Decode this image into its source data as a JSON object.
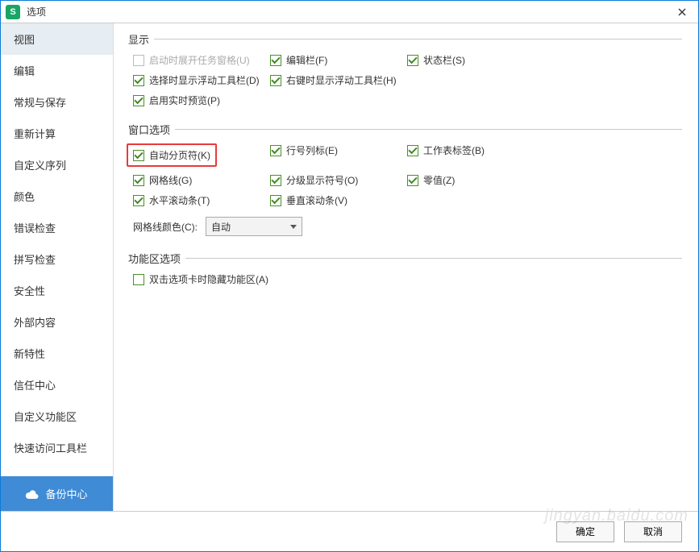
{
  "window": {
    "title": "选项",
    "app_icon_letter": "S"
  },
  "sidebar": {
    "items": [
      {
        "label": "视图",
        "active": true
      },
      {
        "label": "编辑"
      },
      {
        "label": "常规与保存"
      },
      {
        "label": "重新计算"
      },
      {
        "label": "自定义序列"
      },
      {
        "label": "颜色"
      },
      {
        "label": "错误检查"
      },
      {
        "label": "拼写检查"
      },
      {
        "label": "安全性"
      },
      {
        "label": "外部内容"
      },
      {
        "label": "新特性"
      },
      {
        "label": "信任中心"
      },
      {
        "label": "自定义功能区"
      },
      {
        "label": "快速访问工具栏"
      }
    ],
    "backup_label": "备份中心"
  },
  "sections": {
    "display": {
      "title": "显示",
      "items": [
        {
          "label": "启动时展开任务窗格(U)",
          "checked": false,
          "disabled": true
        },
        {
          "label": "编辑栏(F)",
          "checked": true
        },
        {
          "label": "状态栏(S)",
          "checked": true
        },
        {
          "label": "选择时显示浮动工具栏(D)",
          "checked": true
        },
        {
          "label": "右键时显示浮动工具栏(H)",
          "checked": true
        },
        {
          "label": "",
          "checked": false,
          "hidden": true
        },
        {
          "label": "启用实时预览(P)",
          "checked": true
        }
      ]
    },
    "window": {
      "title": "窗口选项",
      "items": [
        {
          "label": "自动分页符(K)",
          "checked": true,
          "highlight": true
        },
        {
          "label": "行号列标(E)",
          "checked": true
        },
        {
          "label": "工作表标签(B)",
          "checked": true
        },
        {
          "label": "网格线(G)",
          "checked": true
        },
        {
          "label": "分级显示符号(O)",
          "checked": true
        },
        {
          "label": "零值(Z)",
          "checked": true
        },
        {
          "label": "水平滚动条(T)",
          "checked": true
        },
        {
          "label": "垂直滚动条(V)",
          "checked": true
        }
      ],
      "color_label": "网格线颜色(C):",
      "color_value": "自动"
    },
    "ribbon": {
      "title": "功能区选项",
      "items": [
        {
          "label": "双击选项卡时隐藏功能区(A)",
          "checked": false
        }
      ]
    }
  },
  "footer": {
    "ok_label": "确定",
    "cancel_label": "取消"
  },
  "watermark": "jingyan.baidu.com"
}
